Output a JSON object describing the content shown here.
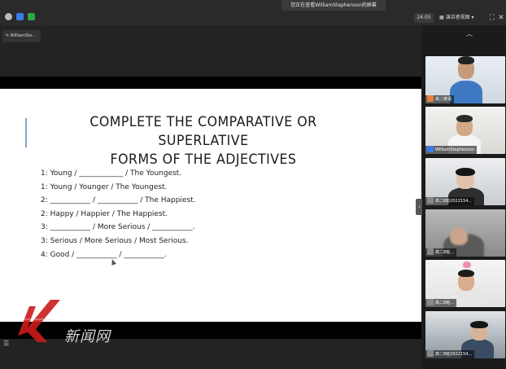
{
  "topbar": {
    "banner": "您正在查看WilliamStephenson的屏幕",
    "timer": "24:05",
    "layout_label": "演讲者视图",
    "icons": [
      "info-icon",
      "shield-icon",
      "signal-icon",
      "layout-icon",
      "chevron-down-icon",
      "fullscreen-icon",
      "close-icon"
    ]
  },
  "presenter_tag": "WilliamSte...",
  "slide": {
    "title_line1": "COMPLETE THE COMPARATIVE OR SUPERLATIVE",
    "title_line2": "FORMS OF THE ADJECTIVES",
    "lines": [
      "1: Young / ____________ / The Youngest.",
      "1: Young / Younger / The Youngest.",
      "2: ___________ / ___________ / The Happiest.",
      "2: Happy / Happier / The Happiest.",
      "3: ___________ / More Serious / ___________.",
      "3: Serious / More Serious / Most Serious.",
      "4: Good / ___________ / ___________."
    ],
    "accent_color": "#7fa7c9"
  },
  "watermark": {
    "text": "新闻网"
  },
  "participants": [
    {
      "name": "高二英语",
      "mic_color": "#e8803a"
    },
    {
      "name": "WilliamStephenson",
      "mic_color": "#3a7be8"
    },
    {
      "name": "高二8班2022154...",
      "mic_color": "#888888"
    },
    {
      "name": "高二8班...",
      "mic_color": "#888888"
    },
    {
      "name": "高二8班...",
      "mic_color": "#888888"
    },
    {
      "name": "高二8班2022154...",
      "mic_color": "#888888"
    }
  ]
}
